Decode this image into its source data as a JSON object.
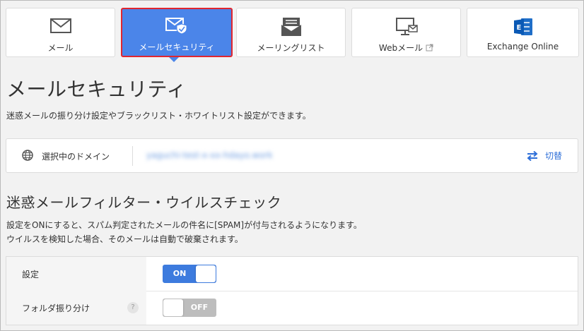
{
  "tabs": [
    {
      "label": "メール",
      "icon": "envelope-icon",
      "active": false
    },
    {
      "label": "メールセキュリティ",
      "icon": "mail-shield-icon",
      "active": true
    },
    {
      "label": "メーリングリスト",
      "icon": "mailing-list-icon",
      "active": false
    },
    {
      "label": "Webメール",
      "icon": "webmail-monitor-icon",
      "external_icon": "external-link-icon",
      "active": false
    },
    {
      "label": "Exchange Online",
      "icon": "exchange-logo-icon",
      "active": false
    }
  ],
  "page": {
    "title": "メールセキュリティ",
    "description": "迷惑メールの振り分け設定やブラックリスト・ホワイトリスト設定ができます。"
  },
  "domain": {
    "label": "選択中のドメイン",
    "value": "yaguchi-test-x-xx-hdayo.work",
    "switch_label": "切替",
    "icon": "globe-icon",
    "switch_icon": "swap-arrows-icon"
  },
  "filter": {
    "heading": "迷惑メールフィルター・ウイルスチェック",
    "note_line1": "設定をONにすると、スパム判定されたメールの件名に[SPAM]が付与されるようになります。",
    "note_line2": "ウイルスを検知した場合、そのメールは自動で破棄されます。",
    "rows": [
      {
        "label": "設定",
        "toggle_text": "ON",
        "state": "on"
      },
      {
        "label": "フォルダ振り分け",
        "help": "?",
        "toggle_text": "OFF",
        "state": "off"
      }
    ]
  },
  "colors": {
    "accent": "#4b85e9",
    "active_border": "#e0262f",
    "link": "#2e6fd8",
    "toggle_off": "#bdbdbd"
  }
}
